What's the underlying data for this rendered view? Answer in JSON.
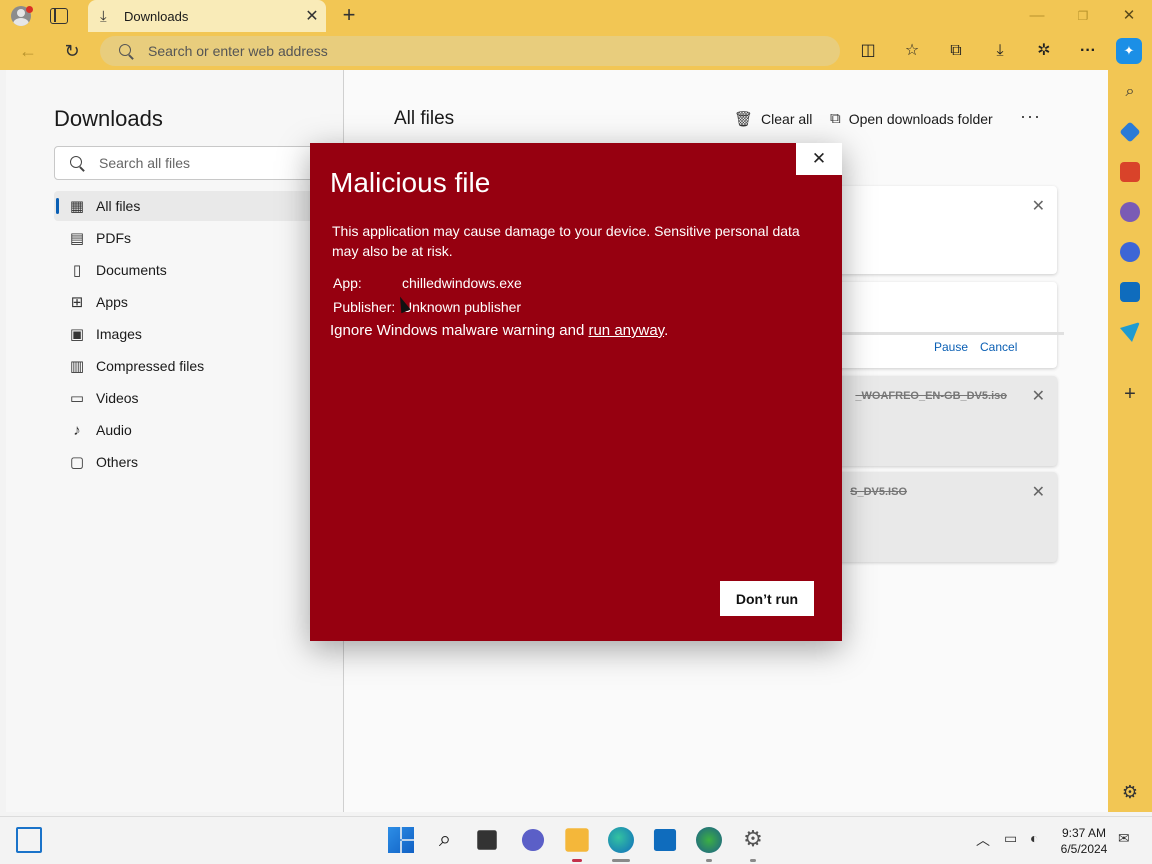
{
  "titlebar": {
    "tab_title": "Downloads",
    "new_tab": "+",
    "minimize": "—",
    "restore": "❐",
    "close": "✕"
  },
  "addressbar": {
    "placeholder": "Search or enter web address"
  },
  "leftpane": {
    "title": "Downloads",
    "search_placeholder": "Search all files",
    "categories": [
      {
        "label": "All files",
        "icon": "grid-icon"
      },
      {
        "label": "PDFs",
        "icon": "pdf-icon"
      },
      {
        "label": "Documents",
        "icon": "document-icon"
      },
      {
        "label": "Apps",
        "icon": "apps-icon"
      },
      {
        "label": "Images",
        "icon": "image-icon"
      },
      {
        "label": "Compressed files",
        "icon": "zip-icon"
      },
      {
        "label": "Videos",
        "icon": "video-icon"
      },
      {
        "label": "Audio",
        "icon": "audio-icon"
      },
      {
        "label": "Others",
        "icon": "other-icon"
      }
    ]
  },
  "rightpane": {
    "title": "All files",
    "clear_all": "Clear all",
    "open_folder": "Open downloads folder",
    "more": "···",
    "items": [
      {
        "filename": "",
        "pause": "",
        "cancel": ""
      },
      {
        "filename": "",
        "pause": "Pause",
        "cancel": "Cancel"
      },
      {
        "filename": "_WOAFREO_EN-GB_DV5.iso"
      },
      {
        "filename": "S_DV5.ISO"
      }
    ]
  },
  "dialog": {
    "title": "Malicious file",
    "message": "This application may cause damage to your device. Sensitive personal data may also be at risk.",
    "app_key": "App:",
    "app_value": "chilledwindows.exe",
    "publisher_key": "Publisher:",
    "publisher_value": "Unknown publisher",
    "ignore_text": "Ignore Windows malware warning and ",
    "run_anyway": "run anyway",
    "period": ".",
    "dont_run": "Don’t run",
    "close": "✕"
  },
  "taskbar": {
    "time": "9:37 AM",
    "date": "6/5/2024"
  },
  "colors": {
    "chrome": "#f2c654",
    "dialog": "#960010",
    "accent": "#0a5fb4"
  }
}
